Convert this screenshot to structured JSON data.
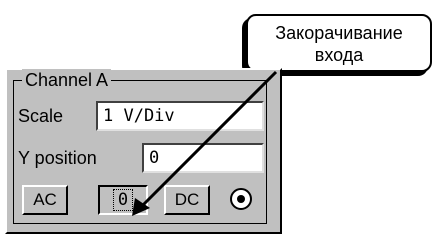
{
  "callout": {
    "line1": "Закорачивание",
    "line2": "входа"
  },
  "channel_panel": {
    "title": "Channel A",
    "scale_label": "Scale",
    "scale_value": "1  V/Div",
    "ypos_label": "Y position",
    "ypos_value": "0",
    "buttons": {
      "ac": "AC",
      "zero": "0",
      "dc": "DC"
    }
  }
}
